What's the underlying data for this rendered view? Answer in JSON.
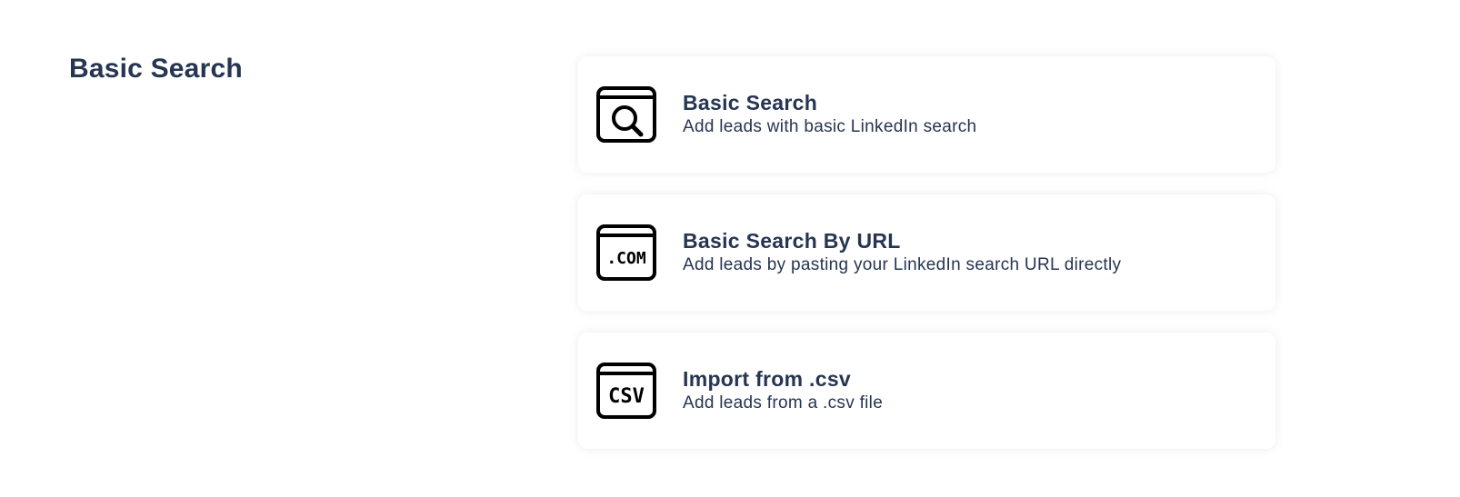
{
  "section": {
    "title": "Basic Search"
  },
  "options": [
    {
      "title": "Basic Search",
      "description": "Add leads with basic LinkedIn search",
      "icon": "browser-search-icon"
    },
    {
      "title": "Basic Search By URL",
      "description": "Add leads by pasting your LinkedIn search URL directly",
      "icon": "browser-dotcom-icon",
      "icon_text": ".COM"
    },
    {
      "title": "Import from .csv",
      "description": "Add leads from a .csv file",
      "icon": "browser-csv-icon",
      "icon_text": "CSV"
    }
  ]
}
